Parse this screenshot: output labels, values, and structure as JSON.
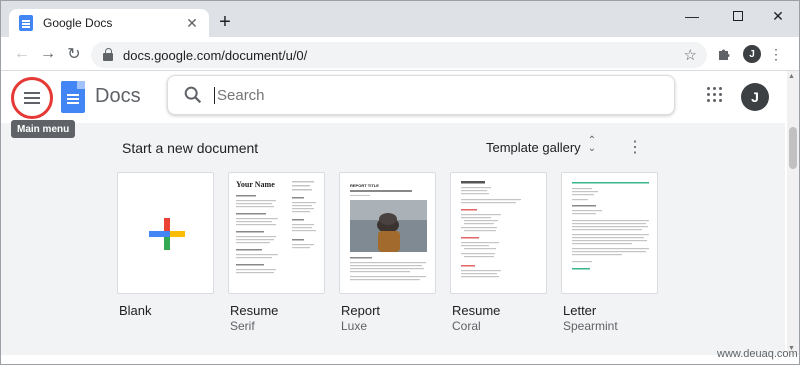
{
  "browser": {
    "tab_title": "Google Docs",
    "url": "docs.google.com/document/u/0/",
    "profile_initial": "J"
  },
  "app": {
    "name": "Docs",
    "search_placeholder": "Search",
    "account_initial": "J",
    "tooltip": "Main menu"
  },
  "templates": {
    "section_title": "Start a new document",
    "gallery_label": "Template gallery",
    "items": [
      {
        "name": "Blank",
        "subtitle": ""
      },
      {
        "name": "Resume",
        "subtitle": "Serif"
      },
      {
        "name": "Report",
        "subtitle": "Luxe"
      },
      {
        "name": "Resume",
        "subtitle": "Coral"
      },
      {
        "name": "Letter",
        "subtitle": "Spearmint"
      }
    ]
  },
  "previews": {
    "resume_serif_name": "Your Name",
    "report_title": "REPORT TITLE"
  },
  "watermark": "www.deuaq.com",
  "colors": {
    "accent_blue": "#4285f4",
    "highlight_red": "#e53935",
    "plus_red": "#ea4335",
    "plus_blue": "#4285f4",
    "plus_green": "#34a853",
    "plus_yellow": "#fbbc04",
    "coral": "#e06666",
    "spearmint": "#38b68a"
  }
}
